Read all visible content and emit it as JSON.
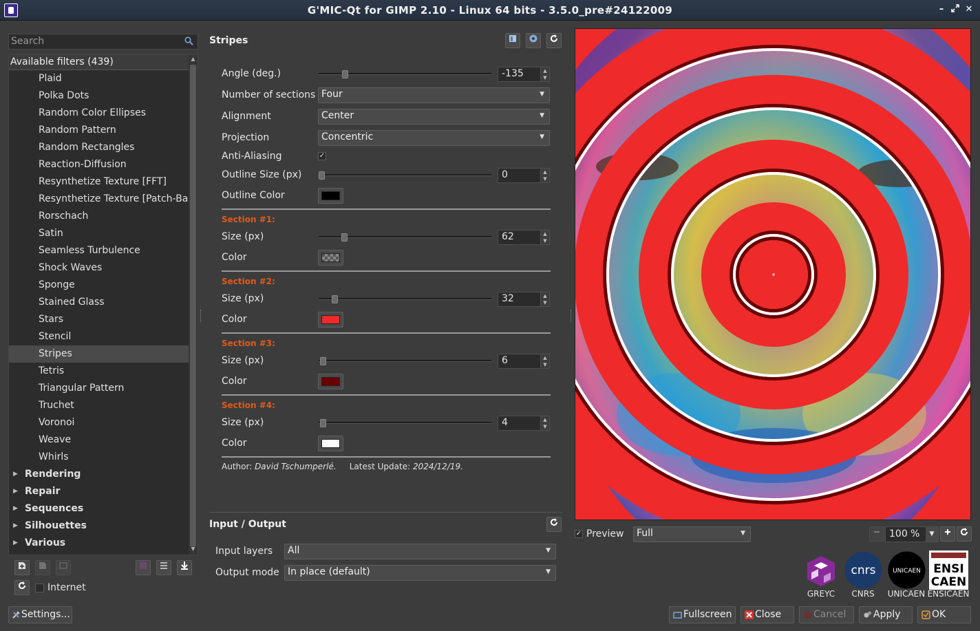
{
  "window": {
    "title": "G'MIC-Qt for GIMP 2.10 - Linux 64 bits - 3.5.0_pre#24122009"
  },
  "search": {
    "placeholder": "Search"
  },
  "filters": {
    "header": "Available filters (439)",
    "items": [
      {
        "label": "Plaid",
        "folder": false
      },
      {
        "label": "Polka Dots",
        "folder": false
      },
      {
        "label": "Random Color Ellipses",
        "folder": false
      },
      {
        "label": "Random Pattern",
        "folder": false
      },
      {
        "label": "Random Rectangles",
        "folder": false
      },
      {
        "label": "Reaction-Diffusion",
        "folder": false
      },
      {
        "label": "Resynthetize Texture [FFT]",
        "folder": false
      },
      {
        "label": "Resynthetize Texture [Patch-Bas",
        "folder": false
      },
      {
        "label": "Rorschach",
        "folder": false
      },
      {
        "label": "Satin",
        "folder": false
      },
      {
        "label": "Seamless Turbulence",
        "folder": false
      },
      {
        "label": "Shock Waves",
        "folder": false
      },
      {
        "label": "Sponge",
        "folder": false
      },
      {
        "label": "Stained Glass",
        "folder": false
      },
      {
        "label": "Stars",
        "folder": false
      },
      {
        "label": "Stencil",
        "folder": false
      },
      {
        "label": "Stripes",
        "folder": false,
        "selected": true
      },
      {
        "label": "Tetris",
        "folder": false
      },
      {
        "label": "Triangular Pattern",
        "folder": false
      },
      {
        "label": "Truchet",
        "folder": false
      },
      {
        "label": "Voronoi",
        "folder": false
      },
      {
        "label": "Weave",
        "folder": false
      },
      {
        "label": "Whirls",
        "folder": false
      },
      {
        "label": "Rendering",
        "folder": true
      },
      {
        "label": "Repair",
        "folder": true
      },
      {
        "label": "Sequences",
        "folder": true
      },
      {
        "label": "Silhouettes",
        "folder": true
      },
      {
        "label": "Various",
        "folder": true
      }
    ]
  },
  "left_footer": {
    "internet_label": "Internet",
    "settings_label": "Settings..."
  },
  "filter": {
    "title": "Stripes",
    "params": {
      "angle": {
        "label": "Angle (deg.)",
        "value": "-135",
        "fraction": 0.14
      },
      "sections": {
        "label": "Number of sections",
        "value": "Four"
      },
      "alignment": {
        "label": "Alignment",
        "value": "Center"
      },
      "projection": {
        "label": "Projection",
        "value": "Concentric"
      },
      "antialiasing": {
        "label": "Anti-Aliasing",
        "checked": true
      },
      "outline_size": {
        "label": "Outline Size (px)",
        "value": "0",
        "fraction": 0.0
      },
      "outline_color": {
        "label": "Outline Color",
        "color": "#000000"
      }
    },
    "sections": [
      {
        "title": "Section #1:",
        "size_label": "Size (px)",
        "size": "62",
        "fraction": 0.135,
        "color_label": "Color",
        "color": "checker"
      },
      {
        "title": "Section #2:",
        "size_label": "Size (px)",
        "size": "32",
        "fraction": 0.08,
        "color_label": "Color",
        "color": "#ee2a2a"
      },
      {
        "title": "Section #3:",
        "size_label": "Size (px)",
        "size": "6",
        "fraction": 0.01,
        "color_label": "Color",
        "color": "#6a0000"
      },
      {
        "title": "Section #4:",
        "size_label": "Size (px)",
        "size": "4",
        "fraction": 0.007,
        "color_label": "Color",
        "color": "#ffffff"
      }
    ],
    "author_prefix": "Author:",
    "author": "David Tschumperlé.",
    "update_prefix": "Latest Update:",
    "update": "2024/12/19."
  },
  "io": {
    "title": "Input / Output",
    "input_label": "Input layers",
    "input_value": "All",
    "output_label": "Output mode",
    "output_value": "In place (default)"
  },
  "preview": {
    "label": "Preview",
    "checked": true,
    "mode": "Full",
    "zoom": "100 %"
  },
  "logos": [
    "GREYC",
    "CNRS",
    "UNICAEN",
    "ENSICAEN"
  ],
  "logo_text": {
    "cnrs": "cnrs",
    "unicaen": "UNICAEN",
    "ensi": "ENSI",
    "caen": "CAEN"
  },
  "buttons": {
    "fullscreen": "Fullscreen",
    "close": "Close",
    "cancel": "Cancel",
    "apply": "Apply",
    "ok": "OK"
  },
  "colors": {
    "stripe_red": "#ee2a2a",
    "stripe_dark": "#6a0000",
    "section_title": "#e05a1a"
  }
}
